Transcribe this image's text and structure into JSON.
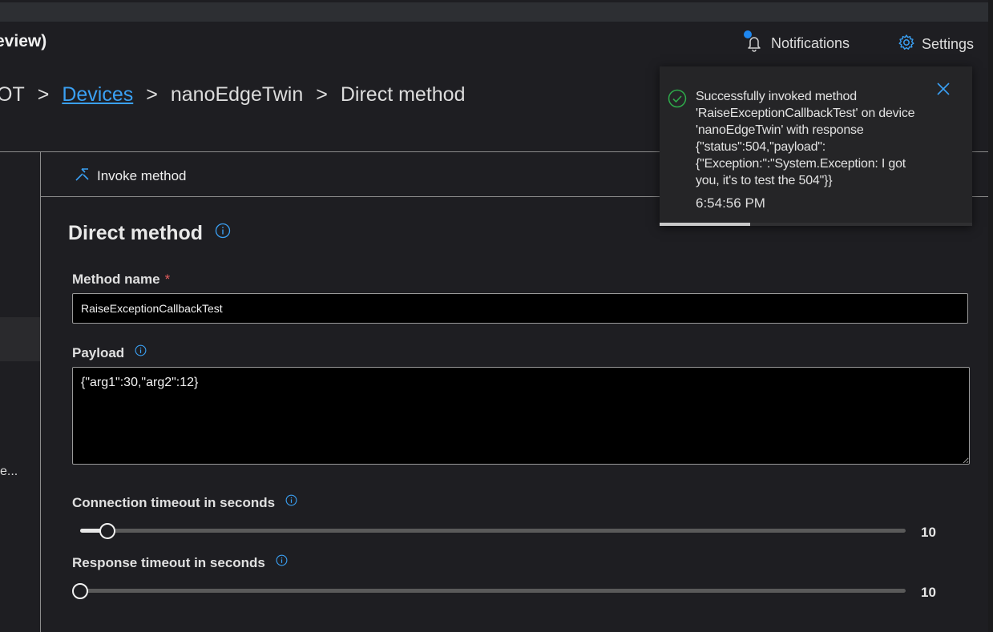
{
  "header": {
    "app_title": "eview)",
    "notifications_label": "Notifications",
    "settings_label": "Settings"
  },
  "breadcrumb": {
    "items": [
      "OT",
      "Devices",
      "nanoEdgeTwin",
      "Direct method"
    ],
    "separator": ">"
  },
  "left_nav": {
    "truncated_label": "e..."
  },
  "toolbar": {
    "invoke_label": "Invoke method"
  },
  "form": {
    "section_title": "Direct method",
    "method_name_label": "Method name",
    "required_marker": "*",
    "method_name_value": "RaiseExceptionCallbackTest",
    "payload_label": "Payload",
    "payload_value": "{\"arg1\":30,\"arg2\":12}",
    "connection_timeout_label": "Connection timeout in seconds",
    "connection_timeout_value": "10",
    "connection_timeout_fraction": 0.033,
    "response_timeout_label": "Response timeout in seconds",
    "response_timeout_value": "10",
    "response_timeout_fraction": 0
  },
  "toast": {
    "message": "Successfully invoked method 'RaiseExceptionCallbackTest' on device 'nanoEdgeTwin' with response {\"status\":504,\"payload\":{\"Exception:\":\"System.Exception: I got you, it's to test the 504\"}}",
    "time": "6:54:56 PM",
    "progress_fraction": 0.29
  },
  "colors": {
    "accent": "#3aa0f3",
    "success": "#2eaa4a",
    "badge": "#1e87f0",
    "required": "#e25c5c",
    "background": "#1e1e22"
  },
  "icons": {
    "notifications": "bell-icon",
    "settings": "gear-icon",
    "invoke": "invoke-method-icon",
    "info": "info-icon",
    "success": "checkmark-circle-icon",
    "close": "close-icon"
  }
}
